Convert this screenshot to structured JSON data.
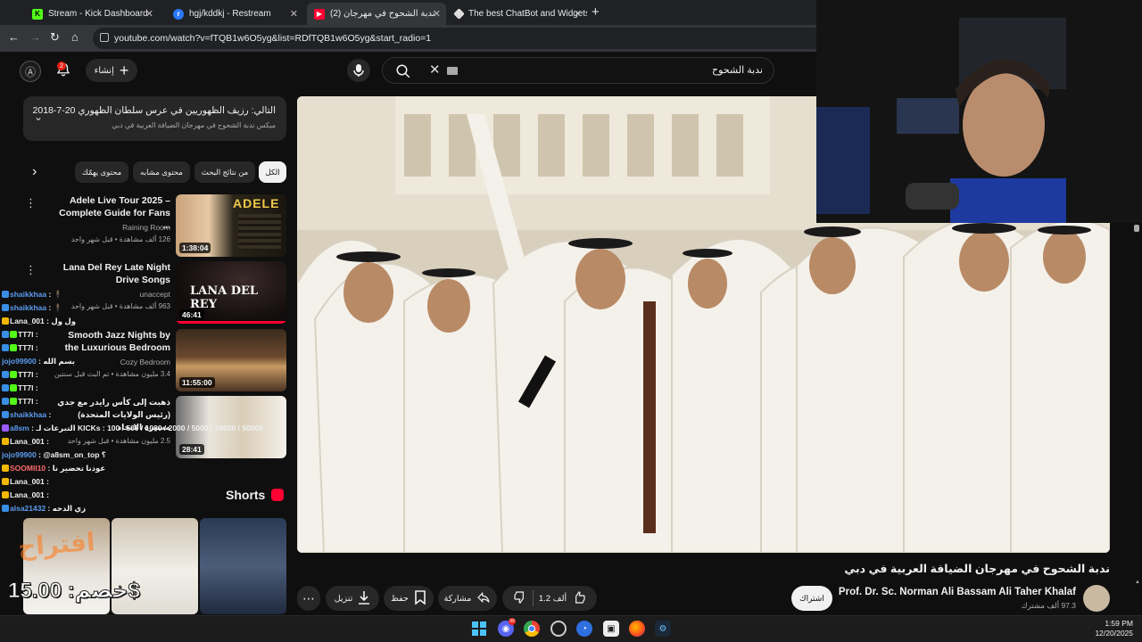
{
  "tabs": [
    {
      "title": "Stream - Kick Dashboard",
      "icon": "kick-icon",
      "active": false
    },
    {
      "title": "hgj/kddkj - Restream",
      "icon": "restream-icon",
      "active": false
    },
    {
      "title": "(2) ندبة الشحوح في مهرجان",
      "icon": "youtube-icon",
      "active": true
    },
    {
      "title": "The best ChatBot and Widgets",
      "icon": "botrix-icon",
      "active": false
    }
  ],
  "address": {
    "url": "youtube.com/watch?v=fTQB1w6O5yg&list=RDfTQB1w6O5yg&start_radio=1"
  },
  "header": {
    "notification_count": "2",
    "create_label": "إنشاء",
    "search_query": "ندبة الشحوح"
  },
  "nextup": {
    "title": "التالي: رزيف الظهوريين في عرس سلطان الظهوري 20-7-2018",
    "subtitle": "ميكس ندبة الشحوح في مهرجان الضيافة العربية في دبي"
  },
  "chips": [
    "الكل",
    "من نتائج البحث",
    "محتوى مشابه",
    "محتوى يهمّك"
  ],
  "recommendations": [
    {
      "title": "Adele Live Tour 2025 – Complete Guide for Fans ...",
      "channel": "Raining Room",
      "meta": "126 ألف مشاهدة • قبل شهر واحد",
      "duration": "1:38:04"
    },
    {
      "title": "Lana Del Rey Late Night Drive Songs",
      "channel": "unaccept",
      "meta": "963 ألف مشاهدة • قبل شهر واحد",
      "duration": "46:41"
    },
    {
      "title": "Smooth Jazz Nights by the Luxurious Bedroom",
      "channel": "Cozy Bedroom",
      "meta": "3.4 مليون مشاهدة • تم البث قبل سنتين",
      "duration": "11:55:00"
    },
    {
      "title": "ذهبت إلى كأس رايدر مع جدي (رئيس الولايات المتحدة) مسيرة الاتحاد",
      "channel": "",
      "meta": "2.5 مليون مشاهدة • قبل شهر واحد",
      "duration": "28:41"
    }
  ],
  "thumb_texts": {
    "adele": "ADELE",
    "lana": "LANA DEL REY"
  },
  "chat": [
    {
      "user": "shaikkhaa",
      "msg": "🕴",
      "color": "blue"
    },
    {
      "user": "shaikkhaa",
      "msg": "🕴",
      "color": "blue"
    },
    {
      "user": "Lana_001",
      "msg": "ول ول",
      "color": "white"
    },
    {
      "user": "TT7l",
      "msg": "",
      "color": "white"
    },
    {
      "user": "TT7l",
      "msg": "",
      "color": "white"
    },
    {
      "user": "jojo99900",
      "msg": "بسم الله",
      "color": "blue"
    },
    {
      "user": "TT7l",
      "msg": "",
      "color": "white"
    },
    {
      "user": "TT7l",
      "msg": "",
      "color": "white"
    },
    {
      "user": "TT7l",
      "msg": "",
      "color": "white"
    },
    {
      "user": "shaikkhaa",
      "msg": "",
      "color": "blue"
    },
    {
      "user": "a8sm",
      "msg": "التبرعات لـ KICKs : 100 / 500 / 1000 / 2000 / 5000 / 10000 / 50000",
      "color": "blue"
    },
    {
      "user": "Lana_001",
      "msg": "",
      "color": "white"
    },
    {
      "user": "jojo99900",
      "msg": "@a8sm_on_top ؟",
      "color": "blue"
    },
    {
      "user": "SOOMII10",
      "msg": "عودنا تحضير نا",
      "color": "red"
    },
    {
      "user": "Lana_001",
      "msg": "",
      "color": "white"
    },
    {
      "user": "Lana_001",
      "msg": "",
      "color": "white"
    },
    {
      "user": "alsa21432",
      "msg": "زي الدحه",
      "color": "blue"
    }
  ],
  "shorts": {
    "title": "Shorts"
  },
  "overlay": {
    "top_text": "افتراح",
    "price_text": "خصم: 15.00$"
  },
  "video": {
    "title": "ندبة الشحوح في مهرجان الضيافة العربية في دبي",
    "channel": "Prof. Dr. Sc. Norman Ali Bassam Ali Taher Khalaf",
    "subscribers": "97.3 ألف مشترك",
    "subscribe_label": "اشتراك",
    "likes": "1.2 ألف",
    "share_label": "مشاركة",
    "save_label": "حفظ",
    "download_label": "تنزيل"
  },
  "taskbar": {
    "time": "1:59 PM",
    "date": "12/20/2025",
    "discord_badge": "99"
  },
  "colors": {
    "kick": "#53fc18",
    "youtube_red": "#ff0033",
    "restream": "#2a78ff",
    "subscribe_bg": "#f1f1f1"
  }
}
